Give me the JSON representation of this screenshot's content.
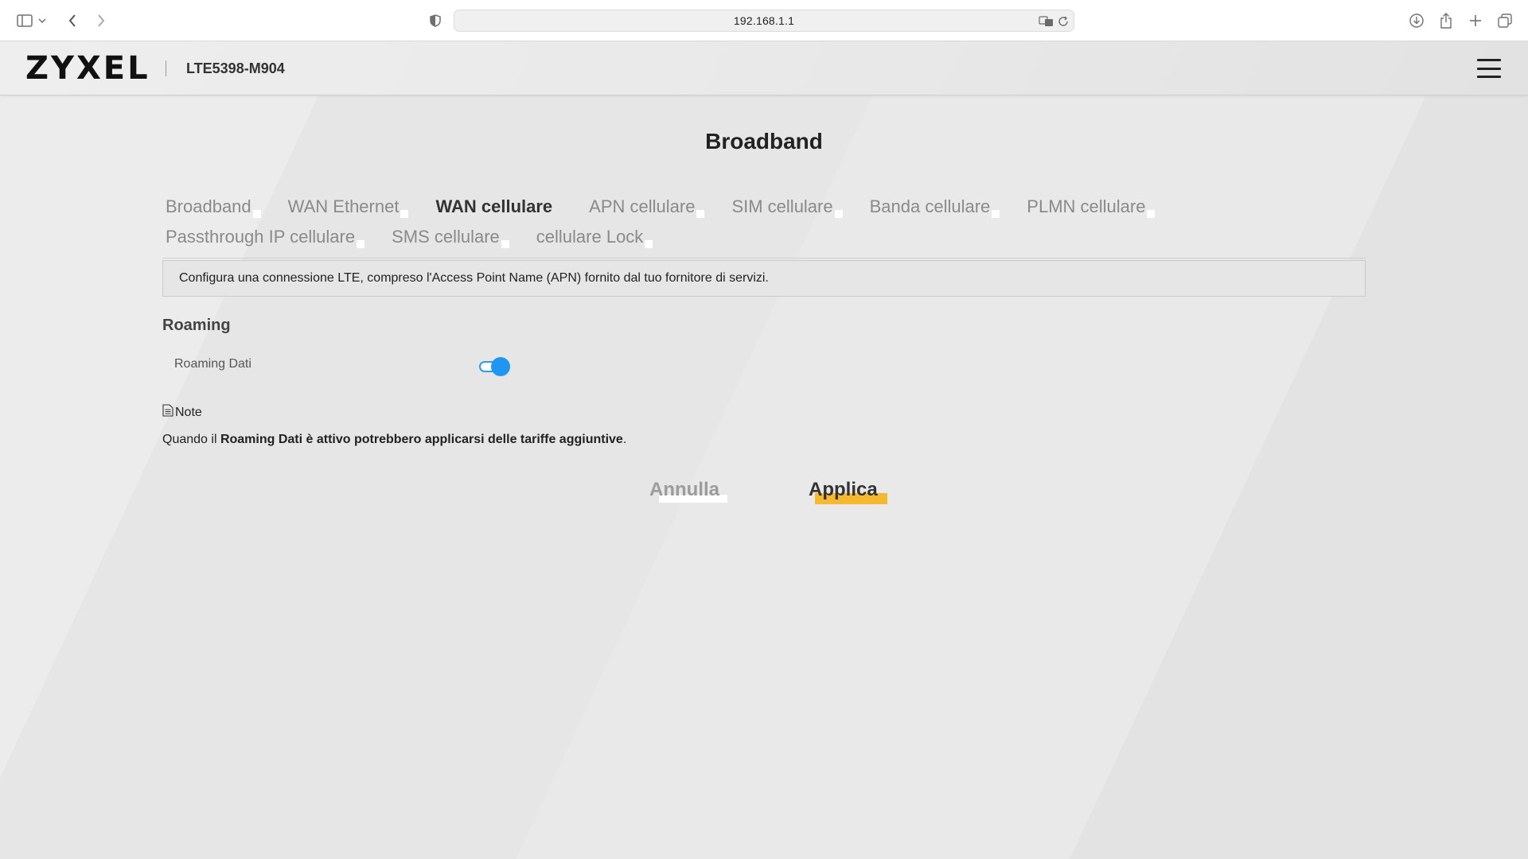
{
  "browser": {
    "url": "192.168.1.1"
  },
  "header": {
    "brand": "ZYXEL",
    "model": "LTE5398-M904"
  },
  "page": {
    "title": "Broadband",
    "tabs": [
      {
        "label": "Broadband",
        "active": false
      },
      {
        "label": "WAN Ethernet",
        "active": false
      },
      {
        "label": "WAN cellulare",
        "active": true
      },
      {
        "label": "APN cellulare",
        "active": false
      },
      {
        "label": "SIM cellulare",
        "active": false
      },
      {
        "label": "Banda cellulare",
        "active": false
      },
      {
        "label": "PLMN cellulare",
        "active": false
      },
      {
        "label": "Passthrough IP cellulare",
        "active": false
      },
      {
        "label": "SMS cellulare",
        "active": false
      },
      {
        "label": "cellulare Lock",
        "active": false
      }
    ],
    "info": "Configura una connessione LTE, compreso l'Access Point Name (APN) fornito dal tuo fornitore di servizi.",
    "section_title": "Roaming",
    "roaming_label": "Roaming Dati",
    "roaming_enabled": true,
    "note": {
      "heading": "Note",
      "prefix": "Quando il ",
      "bold": "Roaming Dati è attivo potrebbero applicarsi delle tariffe aggiuntive",
      "suffix": "."
    },
    "buttons": {
      "cancel": "Annulla",
      "apply": "Applica"
    }
  },
  "colors": {
    "accent": "#f5b82e",
    "toggle": "#2196f0"
  }
}
